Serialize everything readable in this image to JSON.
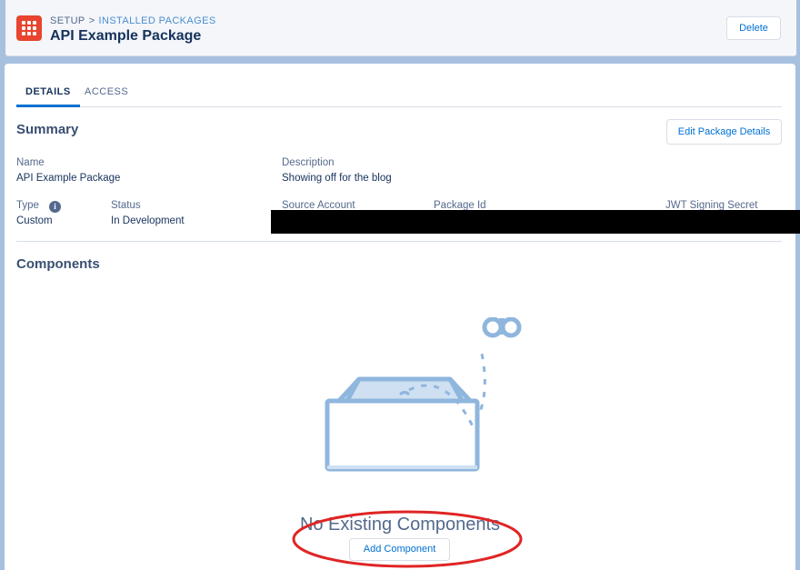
{
  "header": {
    "app_icon": "grid-app-icon",
    "breadcrumb_root": "SETUP",
    "breadcrumb_separator": ">",
    "breadcrumb_current": "INSTALLED PACKAGES",
    "title": "API Example Package",
    "delete_label": "Delete"
  },
  "tabs": [
    {
      "label": "DETAILS",
      "active": true
    },
    {
      "label": "ACCESS",
      "active": false
    }
  ],
  "summary": {
    "title": "Summary",
    "edit_label": "Edit Package Details",
    "name_label": "Name",
    "name_value": "API Example Package",
    "description_label": "Description",
    "description_value": "Showing off for the blog",
    "type_label": "Type",
    "type_value": "Custom",
    "status_label": "Status",
    "status_value": "In Development",
    "source_account_label": "Source Account",
    "package_id_label": "Package Id",
    "jwt_label": "JWT Signing Secret",
    "info_icon": "info-icon"
  },
  "components": {
    "title": "Components",
    "empty_message": "No Existing Components",
    "add_label": "Add Component"
  },
  "colors": {
    "brand": "#0070d2",
    "app_icon": "#e8442f",
    "annotation": "#e02424"
  }
}
